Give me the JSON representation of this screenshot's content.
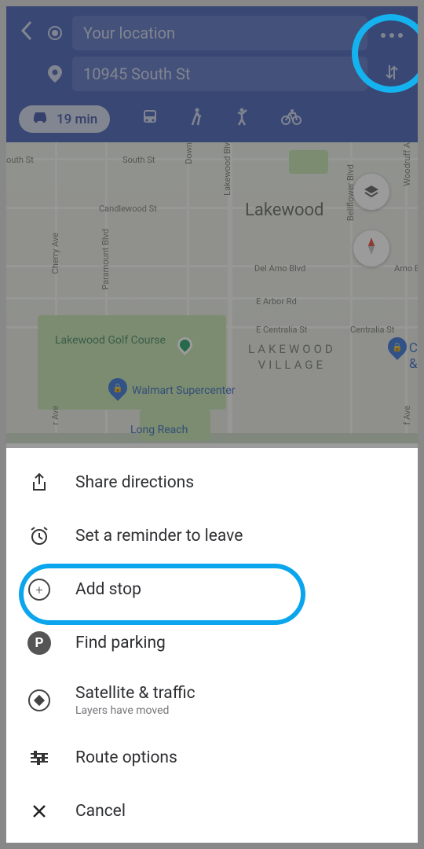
{
  "header": {
    "origin": "Your location",
    "destination": "10945 South St"
  },
  "modes": {
    "drive_time": "19 min"
  },
  "map": {
    "streets": {
      "south_w": "outh St",
      "south": "South St",
      "downey_v": "Down",
      "lakewood_blvd_v": "Lakewood Blv",
      "candlewood": "Candlewood St",
      "bellflower_v": "Bellflower Blvd",
      "woodruff_v": "Woodruff A",
      "cherry_v": "Cherry Ave",
      "paramount_v": "Paramount Blvd",
      "delamo": "Del Amo Blvd",
      "amo_e": "Amo Blv",
      "earbor": "E Arbor Rd",
      "ecentralia": "E Centralia St",
      "centralia_e": "Centralia St",
      "longbeach": "Long Reach",
      "rave_v": "r Ave",
      "fave_v": "f Ave"
    },
    "city": "Lakewood",
    "village_line1": "LAKEWOOD",
    "village_line2": "VILLAGE",
    "golf": "Lakewood Golf Course",
    "walmart": "Walmart Supercenter",
    "co": "C\n&"
  },
  "menu": {
    "share": "Share directions",
    "reminder": "Set a reminder to leave",
    "addstop": "Add stop",
    "parking": "Find parking",
    "satellite": "Satellite & traffic",
    "satellite_sub": "Layers have moved",
    "route": "Route options",
    "cancel": "Cancel"
  }
}
